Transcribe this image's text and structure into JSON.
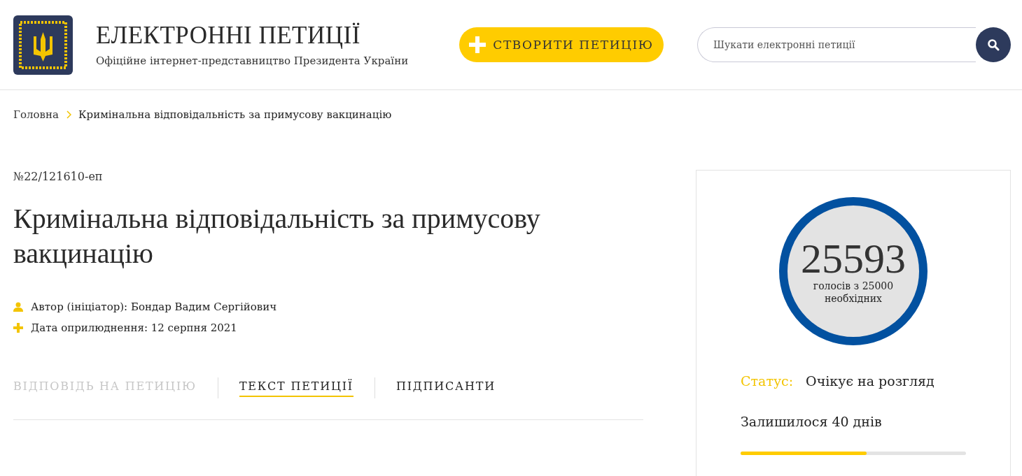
{
  "header": {
    "title": "ЕЛЕКТРОННІ ПЕТИЦІЇ",
    "subtitle": "Офіційне інтернет-представництво Президента України",
    "create_button": "СТВОРИТИ ПЕТИЦІЮ",
    "search": {
      "placeholder": "Шукати електронні петиції"
    }
  },
  "breadcrumbs": [
    {
      "label": "Головна"
    },
    {
      "label": "Кримінальна відповідальність за примусову вакцинацію"
    }
  ],
  "petition": {
    "number": "№22/121610-еп",
    "title": "Кримінальна відповідальність за примусову вакцинацію",
    "meta": [
      {
        "kind": "author",
        "text": "Автор (ініціатор): Бондар Вадим Сергійович"
      },
      {
        "kind": "date",
        "text": "Дата оприлюднення: 12 серпня 2021"
      }
    ]
  },
  "tabs": [
    {
      "label": "ВІДПОВІДЬ НА ПЕТИЦІЮ",
      "selected": false,
      "disabled": true
    },
    {
      "label": "ТЕКСТ ПЕТИЦІЇ",
      "selected": true,
      "disabled": false
    },
    {
      "label": "ПІДПИСАНТИ",
      "selected": false,
      "disabled": false
    }
  ],
  "votes": {
    "count": "25593",
    "caption": "голосів з 25000 необхідних",
    "status_label": "Статус:",
    "status": "Очікує на розгляд",
    "remaining": "Залишилося 40 днів",
    "level": 0.56
  }
}
